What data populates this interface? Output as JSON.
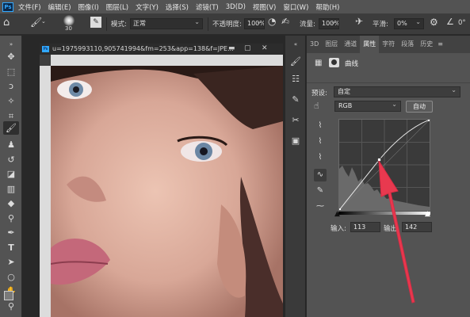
{
  "app": {
    "logo": "Ps"
  },
  "menu": [
    "文件(F)",
    "编辑(E)",
    "图像(I)",
    "图层(L)",
    "文字(Y)",
    "选择(S)",
    "滤镜(T)",
    "3D(D)",
    "视图(V)",
    "窗口(W)",
    "帮助(H)"
  ],
  "options": {
    "brush_size": "30",
    "mode_label": "模式:",
    "mode_value": "正常",
    "opacity_label": "不透明度:",
    "opacity_value": "100%",
    "flow_label": "流量:",
    "flow_value": "100%",
    "smooth_label": "平滑:",
    "smooth_value": "0%",
    "angle_value": "0°"
  },
  "document": {
    "title": "u=1975993110,905741994&fm=253&app=138&f=JPE..."
  },
  "panel": {
    "tabs": [
      "3D",
      "图层",
      "通道",
      "属性",
      "字符",
      "段落",
      "历史"
    ],
    "active_tab": "属性",
    "adjustment_title": "曲线",
    "preset_label": "预设:",
    "preset_value": "自定",
    "channel_value": "RGB",
    "auto_label": "自动",
    "input_label": "输入:",
    "input_value": "113",
    "output_label": "输出:",
    "output_value": "142"
  },
  "curve": {
    "point_input": 113,
    "point_output": 142,
    "range": [
      0,
      255
    ]
  },
  "colors": {
    "accent_arrow": "#e8394f",
    "panel_bg": "#535353",
    "menu_bg": "#535353"
  }
}
